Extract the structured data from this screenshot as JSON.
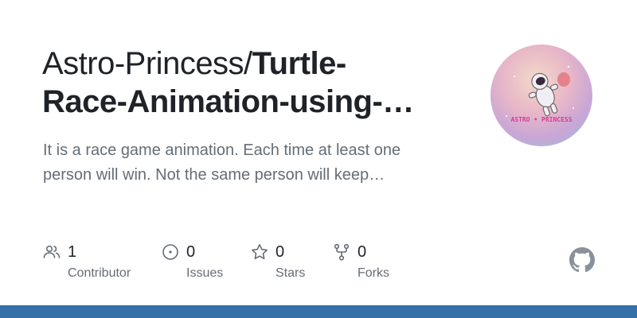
{
  "repo": {
    "owner": "Astro-Princess/",
    "name_line1": "Turtle-",
    "name_line2": "Race-Animation-using-…",
    "description_line1": "It is a race game animation. Each time at least one",
    "description_line2": "person will win. Not the same person will keep…"
  },
  "avatar": {
    "text": "ASTRO • PRINCESS",
    "colors": [
      "#c9a6d6",
      "#e7b6c8",
      "#f3d9c8",
      "#a7b6d9"
    ]
  },
  "stats": [
    {
      "icon": "people-icon",
      "value": "1",
      "label": "Contributor"
    },
    {
      "icon": "issue-icon",
      "value": "0",
      "label": "Issues"
    },
    {
      "icon": "star-icon",
      "value": "0",
      "label": "Stars"
    },
    {
      "icon": "fork-icon",
      "value": "0",
      "label": "Forks"
    }
  ],
  "colors": {
    "text_primary": "#1f2328",
    "text_secondary": "#656d76",
    "bottom_bar": "#3570a8"
  },
  "logo": "github-icon"
}
